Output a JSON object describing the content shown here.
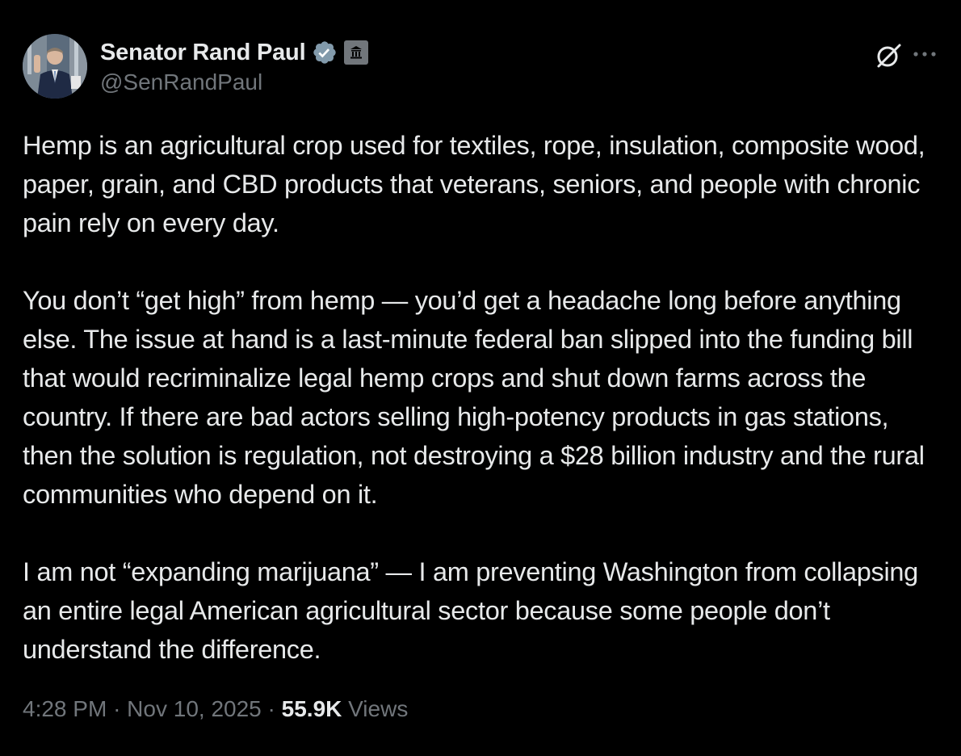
{
  "author": {
    "display_name": "Senator Rand Paul",
    "handle": "@SenRandPaul",
    "verified_badge": "verified-check-icon",
    "affiliation_badge": "government-building-icon"
  },
  "actions": {
    "grok_icon": "grok-slash-circle-icon",
    "more_icon": "ellipsis-icon"
  },
  "tweet": {
    "paragraphs": [
      "Hemp is an agricultural crop used for textiles, rope, insulation, composite wood, paper, grain, and CBD products that veterans, seniors, and people with chronic pain rely on every day.",
      "You don’t “get high” from hemp — you’d get a headache long before anything else. The issue at hand is a last-minute federal ban slipped into the funding bill that would recriminalize legal hemp crops and shut down farms across the country. If there are bad actors selling high-potency products in gas stations, then the solution is regulation, not destroying a $28 billion industry and the rural communities who depend on it.",
      "I am not “expanding marijuana” — I am preventing Washington from collapsing an entire legal American agricultural sector because some people don’t understand the difference."
    ]
  },
  "meta": {
    "time": "4:28 PM",
    "separator": "·",
    "date": "Nov 10, 2025",
    "views_count": "55.9K",
    "views_label": "Views"
  },
  "colors": {
    "background": "#000000",
    "text_primary": "#e7e9ea",
    "text_secondary": "#71767b",
    "verified_badge": "#829aab"
  }
}
